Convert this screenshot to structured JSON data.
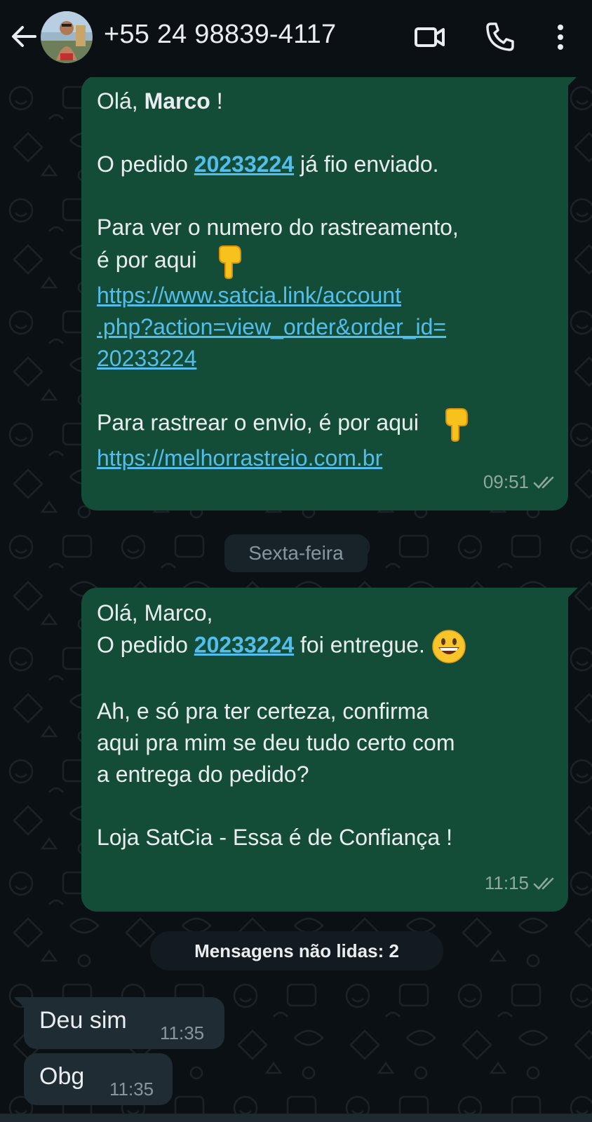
{
  "colors": {
    "background": "#0b1014",
    "outgoing_bubble": "#144d37",
    "incoming_bubble": "#202c33",
    "link": "#53bdeb",
    "header_text": "#e9edef"
  },
  "header": {
    "contact_name": "+55 24 98839-4117",
    "icons": [
      "back-arrow-icon",
      "avatar",
      "video-call-icon",
      "phone-call-icon",
      "more-vert-icon"
    ]
  },
  "messages": {
    "m1": {
      "greeting_prefix": "Olá, ",
      "greeting_name": "Marco",
      "greeting_suffix": " !",
      "order_prefix": "O pedido ",
      "order_number": "20233224",
      "order_suffix": " já fio enviado.",
      "tracking_line1": "Para ver o numero do rastreamento,",
      "tracking_line2": "é por aqui",
      "url_line1": "https://www.satcia.link/account",
      "url_line2": ".php?action=view_order&order_id=",
      "url_line3": "20233224",
      "ship_line": "Para rastrear o envio, é por aqui",
      "ship_url": "https://melhorrastreio.com.br",
      "time": "09:51"
    },
    "date_separator": "Sexta-feira",
    "m2": {
      "greeting": "Olá, Marco,",
      "order_prefix": "O pedido ",
      "order_number": "20233224",
      "order_suffix": " foi entregue.",
      "confirm_line1": "Ah, e só pra ter certeza, confirma",
      "confirm_line2": "aqui pra mim se deu tudo certo com",
      "confirm_line3": "a entrega do pedido?",
      "signature": "Loja SatCia - Essa é de Confiança !",
      "time": "11:15"
    },
    "unread_label": "Mensagens não lidas: 2",
    "incoming": [
      {
        "text": "Deu sim",
        "time": "11:35"
      },
      {
        "text": "Obg",
        "time": "11:35"
      }
    ]
  }
}
